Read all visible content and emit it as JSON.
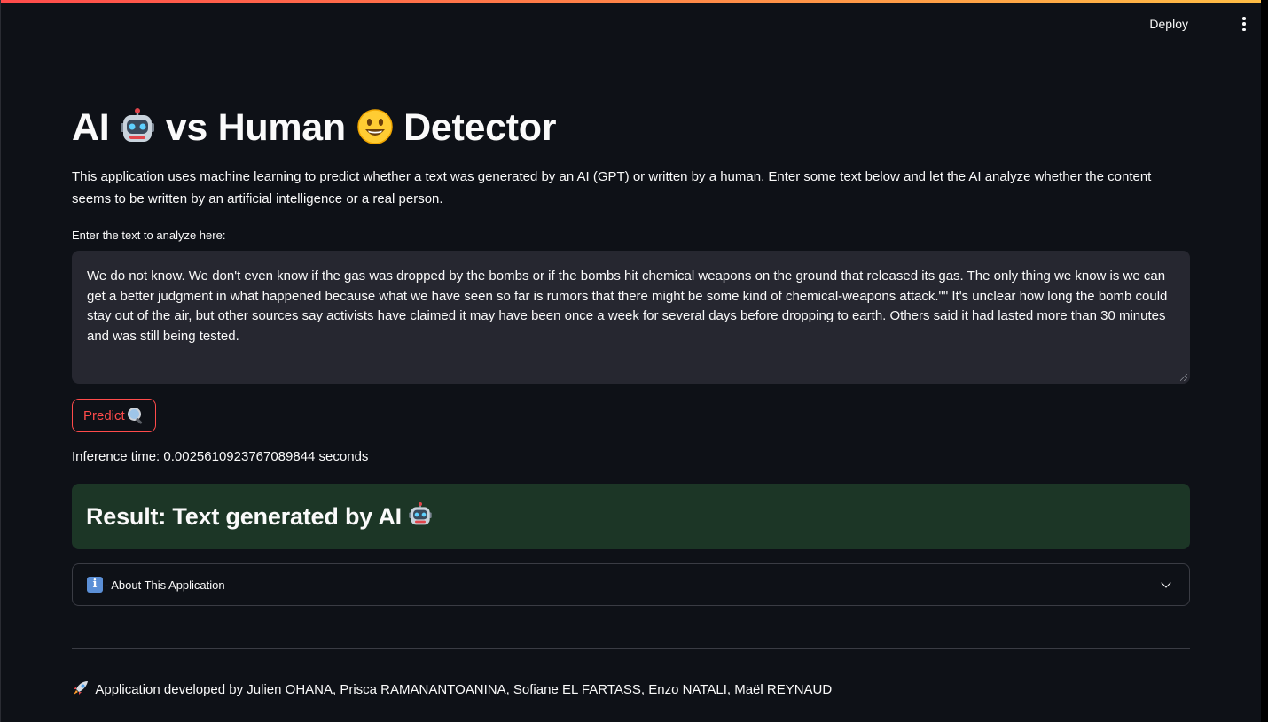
{
  "header": {
    "deploy_label": "Deploy",
    "menu_icon": "kebab-menu-icon"
  },
  "title": {
    "part1": "AI",
    "part2": "vs Human",
    "part3": "Detector",
    "icon1": "robot-emoji-icon",
    "icon2": "smiley-emoji-icon"
  },
  "description": "This application uses machine learning to predict whether a text was generated by an AI (GPT) or written by a human. Enter some text below and let the AI analyze whether the content seems to be written by an artificial intelligence or a real person.",
  "input": {
    "label": "Enter the text to analyze here:",
    "value": "We do not know. We don't even know if the gas was dropped by the bombs or if the bombs hit chemical weapons on the ground that released its gas. The only thing we know is we can get a better judgment in what happened because what we have seen so far is rumors that there might be some kind of chemical-weapons attack.\"\" It's unclear how long the bomb could stay out of the air, but other sources say activists have claimed it may have been once a week for several days before dropping to earth. Others said it had lasted more than 30 minutes and was still being tested."
  },
  "predict": {
    "label": "Predict",
    "icon": "magnifier-icon"
  },
  "inference_text": "Inference time: 0.0025610923767089844 seconds",
  "result": {
    "text": "Result: Text generated by AI",
    "icon": "robot-emoji-icon"
  },
  "expander": {
    "icon": "info-icon",
    "label": "- About This Application",
    "chevron": "chevron-down-icon"
  },
  "footer": {
    "icon": "rocket-icon",
    "text": "Application developed by Julien OHANA, Prisca RAMANANTOANINA, Sofiane EL FARTASS, Enzo NATALI, Maël REYNAUD"
  },
  "colors": {
    "background": "#0e1117",
    "accent": "#ff4b4b",
    "textarea_bg": "#262730",
    "success_bg": "#1c3626",
    "text": "#fafafa"
  }
}
